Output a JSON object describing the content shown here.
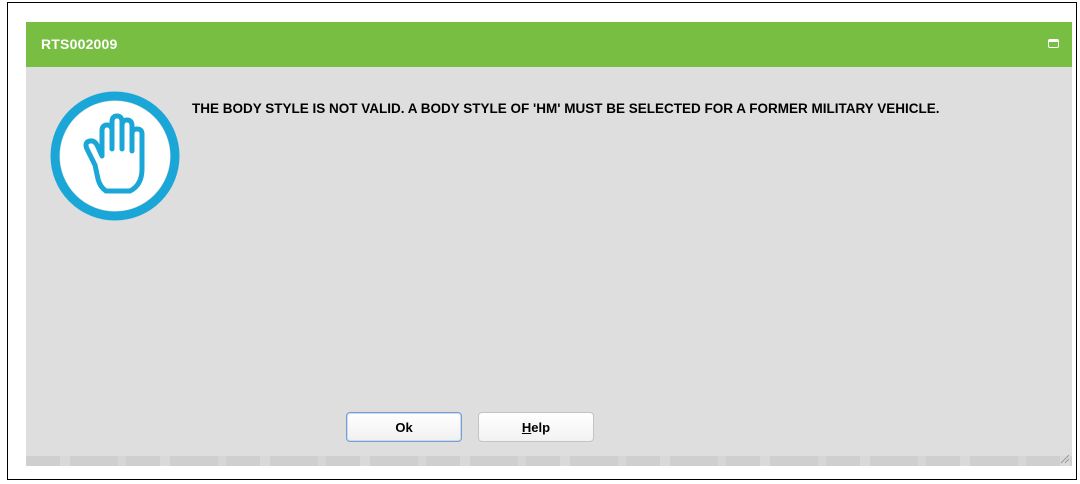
{
  "dialog": {
    "title": "RTS002009",
    "icon": "stop-hand-icon",
    "message": "THE BODY STYLE IS NOT VALID. A BODY STYLE OF 'HM' MUST BE SELECTED FOR A FORMER MILITARY VEHICLE.",
    "buttons": {
      "ok_label": "Ok",
      "help_label_first": "H",
      "help_label_rest": "elp"
    }
  },
  "colors": {
    "titlebar": "#78be43",
    "dialog_background": "#dedede",
    "icon": "#1aa7d8"
  }
}
